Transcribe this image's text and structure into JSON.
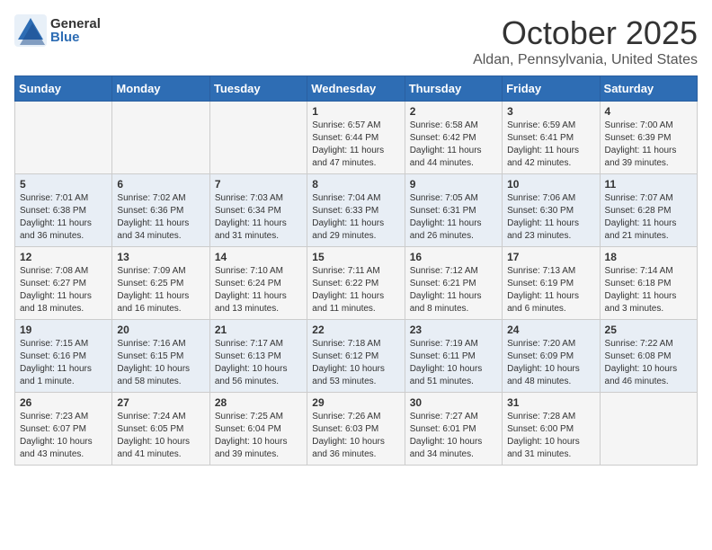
{
  "header": {
    "logo_general": "General",
    "logo_blue": "Blue",
    "month": "October 2025",
    "location": "Aldan, Pennsylvania, United States"
  },
  "days_of_week": [
    "Sunday",
    "Monday",
    "Tuesday",
    "Wednesday",
    "Thursday",
    "Friday",
    "Saturday"
  ],
  "weeks": [
    [
      {
        "day": "",
        "info": ""
      },
      {
        "day": "",
        "info": ""
      },
      {
        "day": "",
        "info": ""
      },
      {
        "day": "1",
        "info": "Sunrise: 6:57 AM\nSunset: 6:44 PM\nDaylight: 11 hours\nand 47 minutes."
      },
      {
        "day": "2",
        "info": "Sunrise: 6:58 AM\nSunset: 6:42 PM\nDaylight: 11 hours\nand 44 minutes."
      },
      {
        "day": "3",
        "info": "Sunrise: 6:59 AM\nSunset: 6:41 PM\nDaylight: 11 hours\nand 42 minutes."
      },
      {
        "day": "4",
        "info": "Sunrise: 7:00 AM\nSunset: 6:39 PM\nDaylight: 11 hours\nand 39 minutes."
      }
    ],
    [
      {
        "day": "5",
        "info": "Sunrise: 7:01 AM\nSunset: 6:38 PM\nDaylight: 11 hours\nand 36 minutes."
      },
      {
        "day": "6",
        "info": "Sunrise: 7:02 AM\nSunset: 6:36 PM\nDaylight: 11 hours\nand 34 minutes."
      },
      {
        "day": "7",
        "info": "Sunrise: 7:03 AM\nSunset: 6:34 PM\nDaylight: 11 hours\nand 31 minutes."
      },
      {
        "day": "8",
        "info": "Sunrise: 7:04 AM\nSunset: 6:33 PM\nDaylight: 11 hours\nand 29 minutes."
      },
      {
        "day": "9",
        "info": "Sunrise: 7:05 AM\nSunset: 6:31 PM\nDaylight: 11 hours\nand 26 minutes."
      },
      {
        "day": "10",
        "info": "Sunrise: 7:06 AM\nSunset: 6:30 PM\nDaylight: 11 hours\nand 23 minutes."
      },
      {
        "day": "11",
        "info": "Sunrise: 7:07 AM\nSunset: 6:28 PM\nDaylight: 11 hours\nand 21 minutes."
      }
    ],
    [
      {
        "day": "12",
        "info": "Sunrise: 7:08 AM\nSunset: 6:27 PM\nDaylight: 11 hours\nand 18 minutes."
      },
      {
        "day": "13",
        "info": "Sunrise: 7:09 AM\nSunset: 6:25 PM\nDaylight: 11 hours\nand 16 minutes."
      },
      {
        "day": "14",
        "info": "Sunrise: 7:10 AM\nSunset: 6:24 PM\nDaylight: 11 hours\nand 13 minutes."
      },
      {
        "day": "15",
        "info": "Sunrise: 7:11 AM\nSunset: 6:22 PM\nDaylight: 11 hours\nand 11 minutes."
      },
      {
        "day": "16",
        "info": "Sunrise: 7:12 AM\nSunset: 6:21 PM\nDaylight: 11 hours\nand 8 minutes."
      },
      {
        "day": "17",
        "info": "Sunrise: 7:13 AM\nSunset: 6:19 PM\nDaylight: 11 hours\nand 6 minutes."
      },
      {
        "day": "18",
        "info": "Sunrise: 7:14 AM\nSunset: 6:18 PM\nDaylight: 11 hours\nand 3 minutes."
      }
    ],
    [
      {
        "day": "19",
        "info": "Sunrise: 7:15 AM\nSunset: 6:16 PM\nDaylight: 11 hours\nand 1 minute."
      },
      {
        "day": "20",
        "info": "Sunrise: 7:16 AM\nSunset: 6:15 PM\nDaylight: 10 hours\nand 58 minutes."
      },
      {
        "day": "21",
        "info": "Sunrise: 7:17 AM\nSunset: 6:13 PM\nDaylight: 10 hours\nand 56 minutes."
      },
      {
        "day": "22",
        "info": "Sunrise: 7:18 AM\nSunset: 6:12 PM\nDaylight: 10 hours\nand 53 minutes."
      },
      {
        "day": "23",
        "info": "Sunrise: 7:19 AM\nSunset: 6:11 PM\nDaylight: 10 hours\nand 51 minutes."
      },
      {
        "day": "24",
        "info": "Sunrise: 7:20 AM\nSunset: 6:09 PM\nDaylight: 10 hours\nand 48 minutes."
      },
      {
        "day": "25",
        "info": "Sunrise: 7:22 AM\nSunset: 6:08 PM\nDaylight: 10 hours\nand 46 minutes."
      }
    ],
    [
      {
        "day": "26",
        "info": "Sunrise: 7:23 AM\nSunset: 6:07 PM\nDaylight: 10 hours\nand 43 minutes."
      },
      {
        "day": "27",
        "info": "Sunrise: 7:24 AM\nSunset: 6:05 PM\nDaylight: 10 hours\nand 41 minutes."
      },
      {
        "day": "28",
        "info": "Sunrise: 7:25 AM\nSunset: 6:04 PM\nDaylight: 10 hours\nand 39 minutes."
      },
      {
        "day": "29",
        "info": "Sunrise: 7:26 AM\nSunset: 6:03 PM\nDaylight: 10 hours\nand 36 minutes."
      },
      {
        "day": "30",
        "info": "Sunrise: 7:27 AM\nSunset: 6:01 PM\nDaylight: 10 hours\nand 34 minutes."
      },
      {
        "day": "31",
        "info": "Sunrise: 7:28 AM\nSunset: 6:00 PM\nDaylight: 10 hours\nand 31 minutes."
      },
      {
        "day": "",
        "info": ""
      }
    ]
  ]
}
